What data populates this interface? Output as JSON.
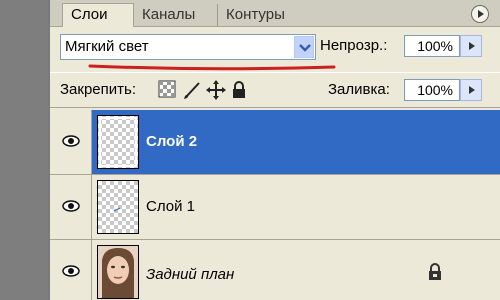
{
  "tabs": [
    {
      "label": "Слои",
      "active": true
    },
    {
      "label": "Каналы",
      "active": false
    },
    {
      "label": "Контуры",
      "active": false
    }
  ],
  "blend_mode": "Мягкий свет",
  "opacity": {
    "label": "Непрозр.:",
    "value": "100%"
  },
  "lock": {
    "label": "Закрепить:"
  },
  "fill": {
    "label": "Заливка:",
    "value": "100%"
  },
  "layers": [
    {
      "name": "Слой 2",
      "selected": true,
      "visible": true
    },
    {
      "name": "Слой 1",
      "selected": false,
      "visible": true
    },
    {
      "name": "Задний план",
      "selected": false,
      "visible": true,
      "locked": true
    }
  ],
  "colors": {
    "panel": "#ece9d8",
    "selection": "#316ac5",
    "annotation": "#cc1f1f"
  }
}
